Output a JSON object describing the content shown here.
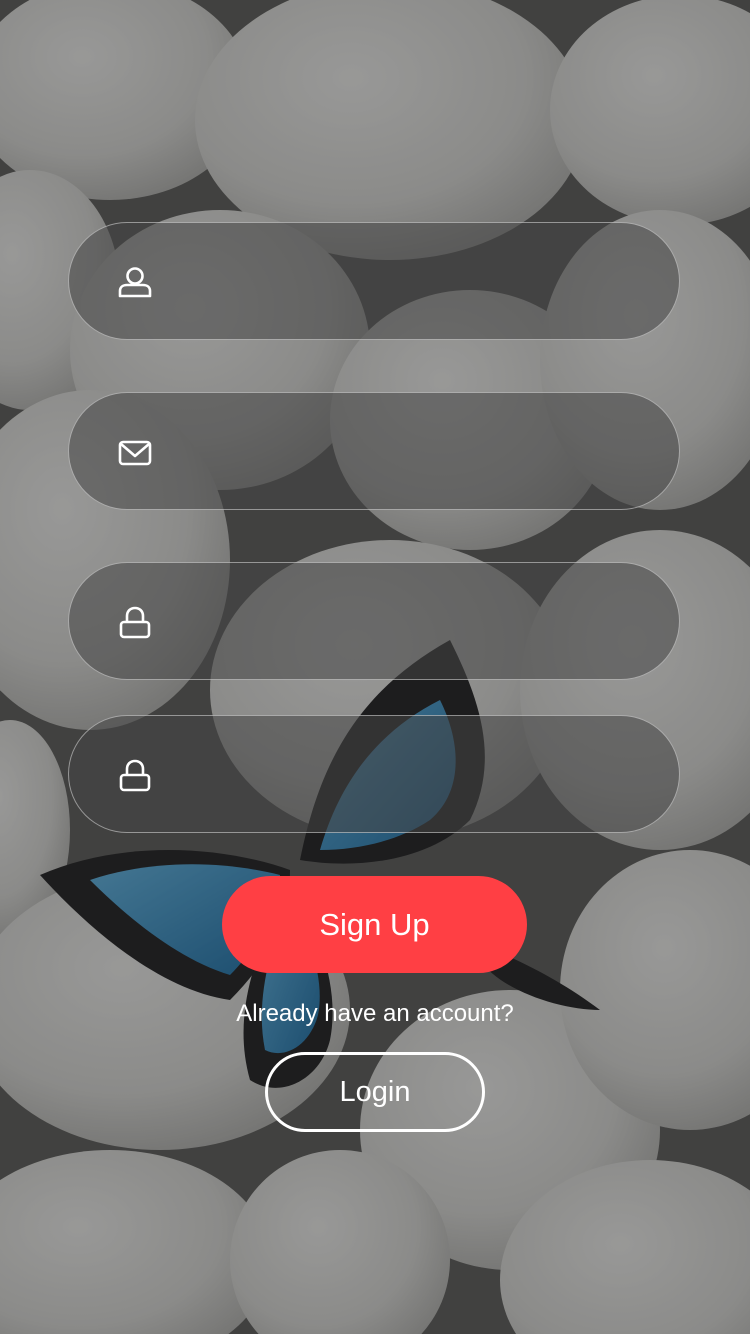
{
  "background": {
    "scene": "stones-butterfly",
    "overlay_color": "#1e1e1e",
    "accent_color": "#ff3f44"
  },
  "form": {
    "fields": [
      {
        "icon": "user-icon",
        "value": "",
        "placeholder": ""
      },
      {
        "icon": "mail-icon",
        "value": "",
        "placeholder": ""
      },
      {
        "icon": "lock-icon",
        "value": "",
        "placeholder": ""
      },
      {
        "icon": "lock-icon",
        "value": "",
        "placeholder": ""
      }
    ],
    "signup_label": "Sign Up",
    "already_text": "Already have an account?",
    "login_label": "Login"
  }
}
